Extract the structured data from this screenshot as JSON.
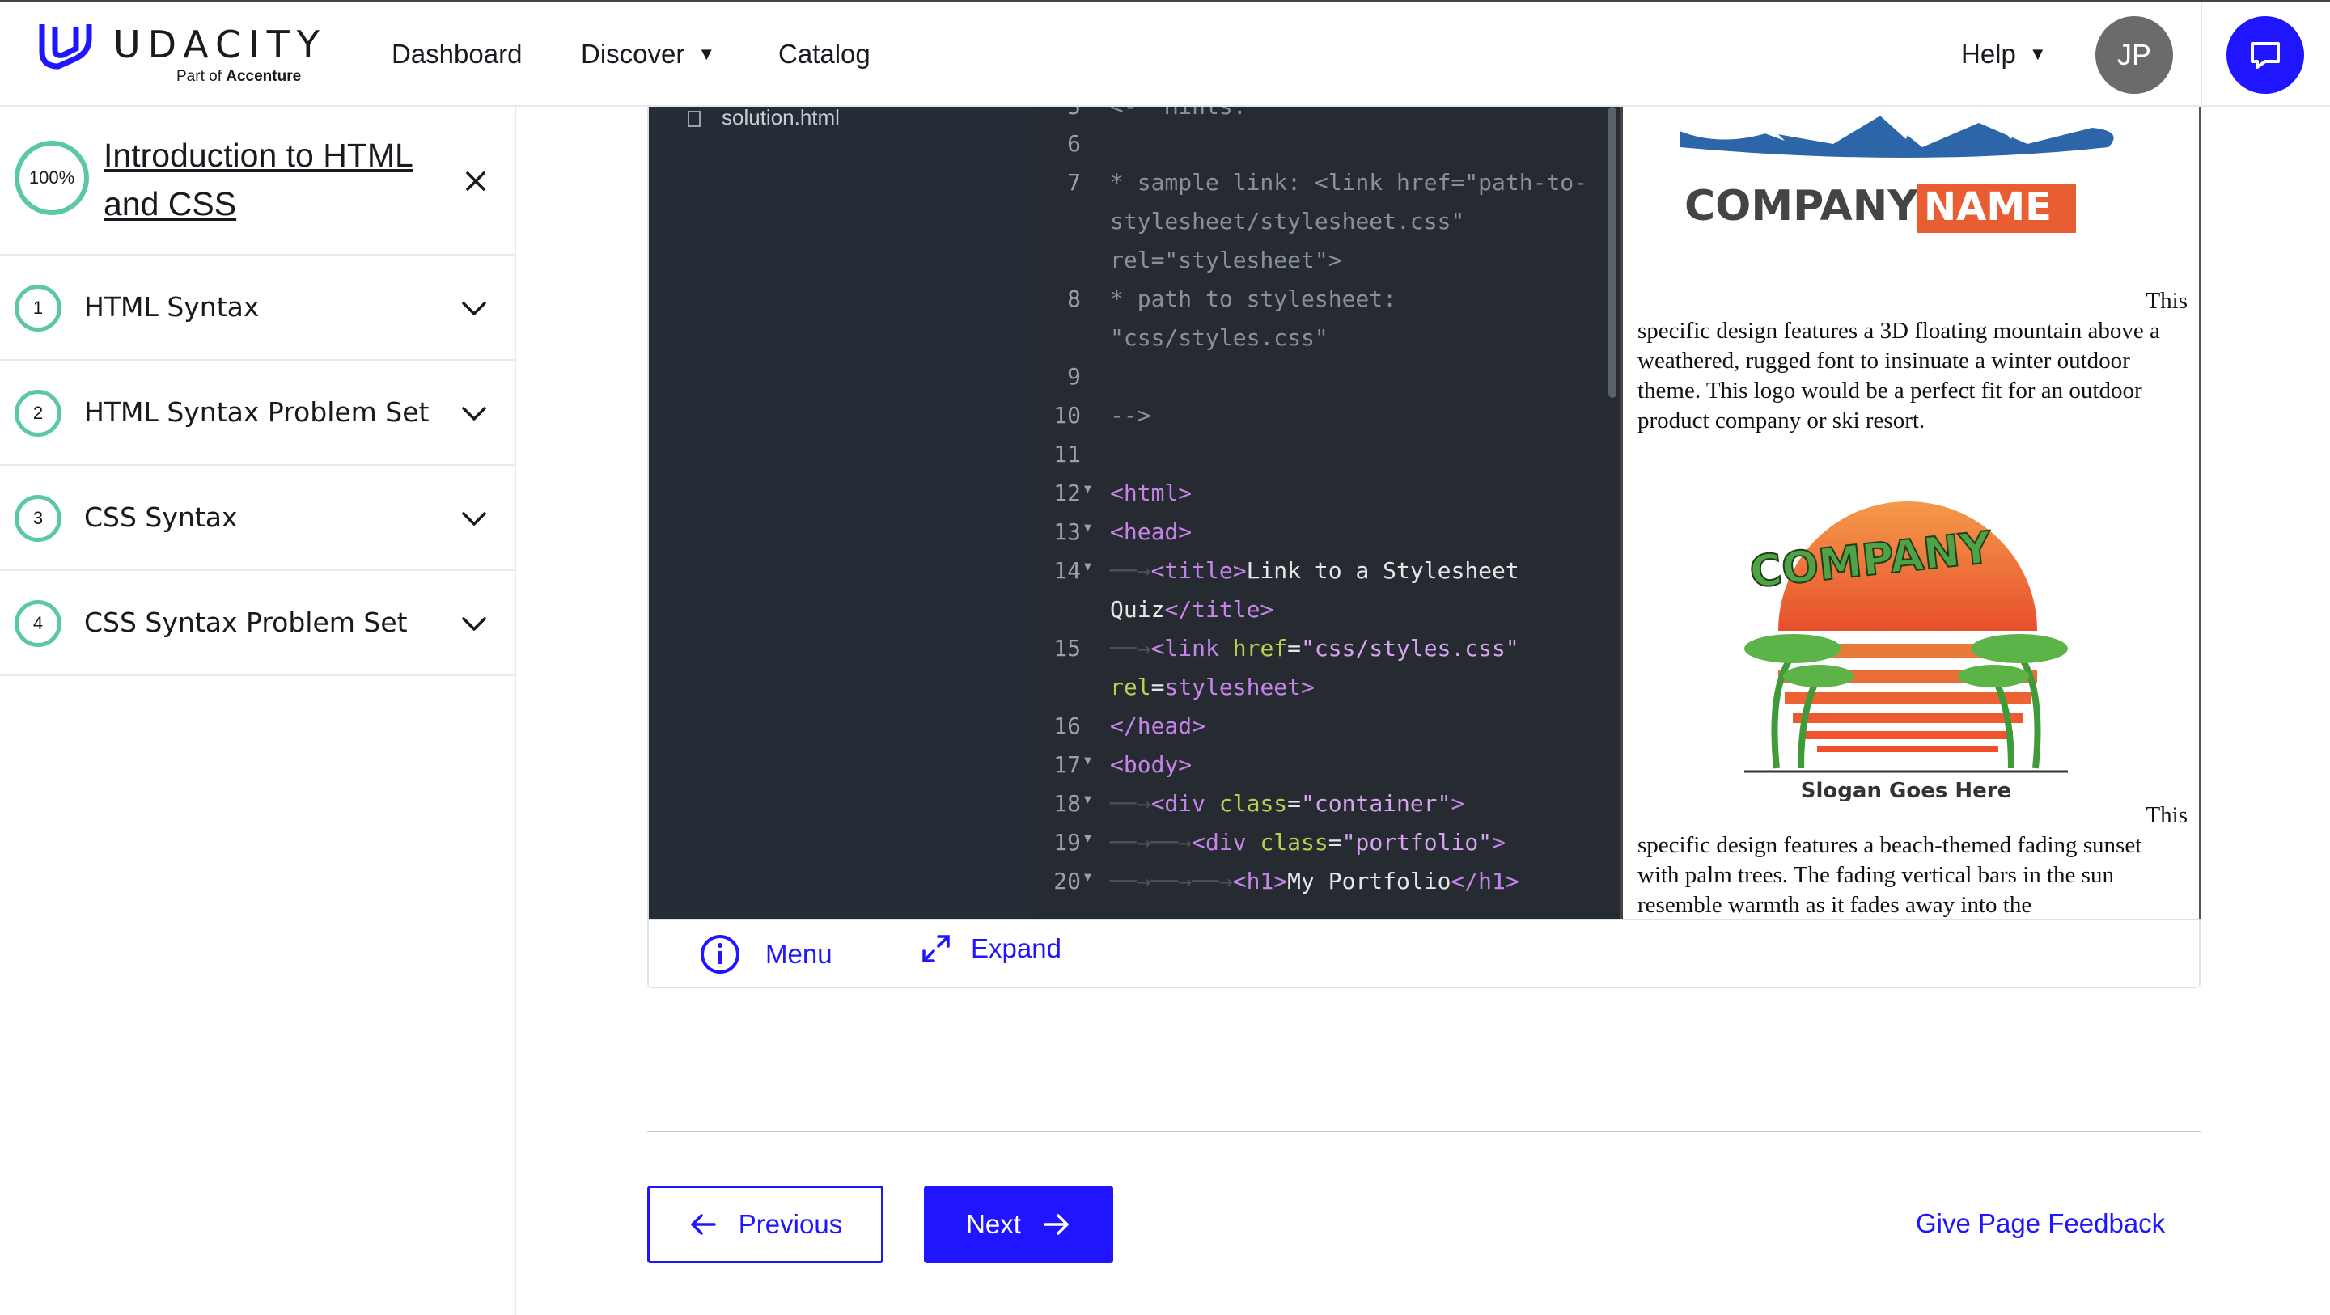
{
  "header": {
    "logo_word": "UDACITY",
    "logo_sub_prefix": "Part of ",
    "logo_sub_brand": "Accenture",
    "nav": {
      "dashboard": "Dashboard",
      "discover": "Discover",
      "catalog": "Catalog",
      "help": "Help"
    },
    "avatar_initials": "JP",
    "accent_color": "#2015ff"
  },
  "sidebar": {
    "progress": "100%",
    "course_title": "Introduction to HTML and CSS",
    "lessons": [
      {
        "num": "1",
        "label": "HTML Syntax"
      },
      {
        "num": "2",
        "label": "HTML Syntax Problem Set"
      },
      {
        "num": "3",
        "label": "CSS Syntax"
      },
      {
        "num": "4",
        "label": "CSS Syntax Problem Set"
      }
    ]
  },
  "workspace": {
    "file_name": "solution.html",
    "preview": {
      "logo1_word1": "COMPANY",
      "logo1_word2": "NAME",
      "para1_lead": "This",
      "para1_rest": "specific design features a 3D floating mountain above a weathered, rugged font to insinuate a winter outdoor theme. This logo would be a perfect fit for an outdoor product company or ski resort.",
      "logo2_word": "COMPANY",
      "logo2_slogan": "Slogan Goes Here",
      "para2_lead": "This",
      "para2_rest": "specific design features a beach-themed fading sunset with palm trees. The fading vertical bars in the sun resemble warmth as it fades away into the"
    },
    "footer": {
      "menu": "Menu",
      "expand": "Expand"
    }
  },
  "navigation": {
    "previous": "Previous",
    "next": "Next",
    "feedback": "Give Page Feedback"
  }
}
